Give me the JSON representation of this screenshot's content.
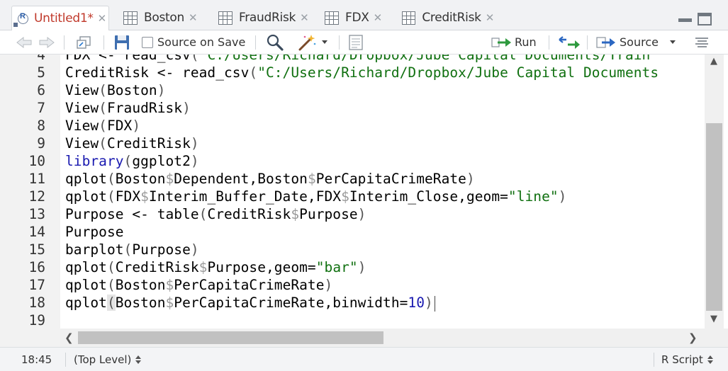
{
  "tabs": [
    {
      "label": "Untitled1*",
      "active": true,
      "icon": "r-script-icon"
    },
    {
      "label": "Boston",
      "active": false,
      "icon": "table-icon"
    },
    {
      "label": "FraudRisk",
      "active": false,
      "icon": "table-icon"
    },
    {
      "label": "FDX",
      "active": false,
      "icon": "table-icon"
    },
    {
      "label": "CreditRisk",
      "active": false,
      "icon": "table-icon"
    }
  ],
  "toolbar": {
    "source_on_save": "Source on Save",
    "run": "Run",
    "source": "Source"
  },
  "editor": {
    "lines": [
      {
        "n": "4",
        "text": "FDX <- read_csv(\"C:/Users/Richard/Dropbox/Jube Capital Documents/Train"
      },
      {
        "n": "5",
        "text": "CreditRisk <- read_csv(\"C:/Users/Richard/Dropbox/Jube Capital Documents"
      },
      {
        "n": "6",
        "text": "View(Boston)"
      },
      {
        "n": "7",
        "text": "View(FraudRisk)"
      },
      {
        "n": "8",
        "text": "View(FDX)"
      },
      {
        "n": "9",
        "text": "View(CreditRisk)"
      },
      {
        "n": "10",
        "text": "library(ggplot2)"
      },
      {
        "n": "11",
        "text": "qplot(Boston$Dependent,Boston$PerCapitaCrimeRate)"
      },
      {
        "n": "12",
        "text": "qplot(FDX$Interim_Buffer_Date,FDX$Interim_Close,geom=\"line\")"
      },
      {
        "n": "13",
        "text": "Purpose <- table(CreditRisk$Purpose)"
      },
      {
        "n": "14",
        "text": "Purpose"
      },
      {
        "n": "15",
        "text": "barplot(Purpose)"
      },
      {
        "n": "16",
        "text": "qplot(CreditRisk$Purpose,geom=\"bar\")"
      },
      {
        "n": "17",
        "text": "qplot(Boston$PerCapitaCrimeRate)"
      },
      {
        "n": "18",
        "text": "qplot(Boston$PerCapitaCrimeRate,binwidth=10)"
      },
      {
        "n": "19",
        "text": ""
      }
    ]
  },
  "status": {
    "position": "18:45",
    "scope": "(Top Level)",
    "file_type": "R Script"
  },
  "colors": {
    "keyword": "#1a1ab0",
    "string": "#107010",
    "active_tab_label": "#c0392b"
  }
}
